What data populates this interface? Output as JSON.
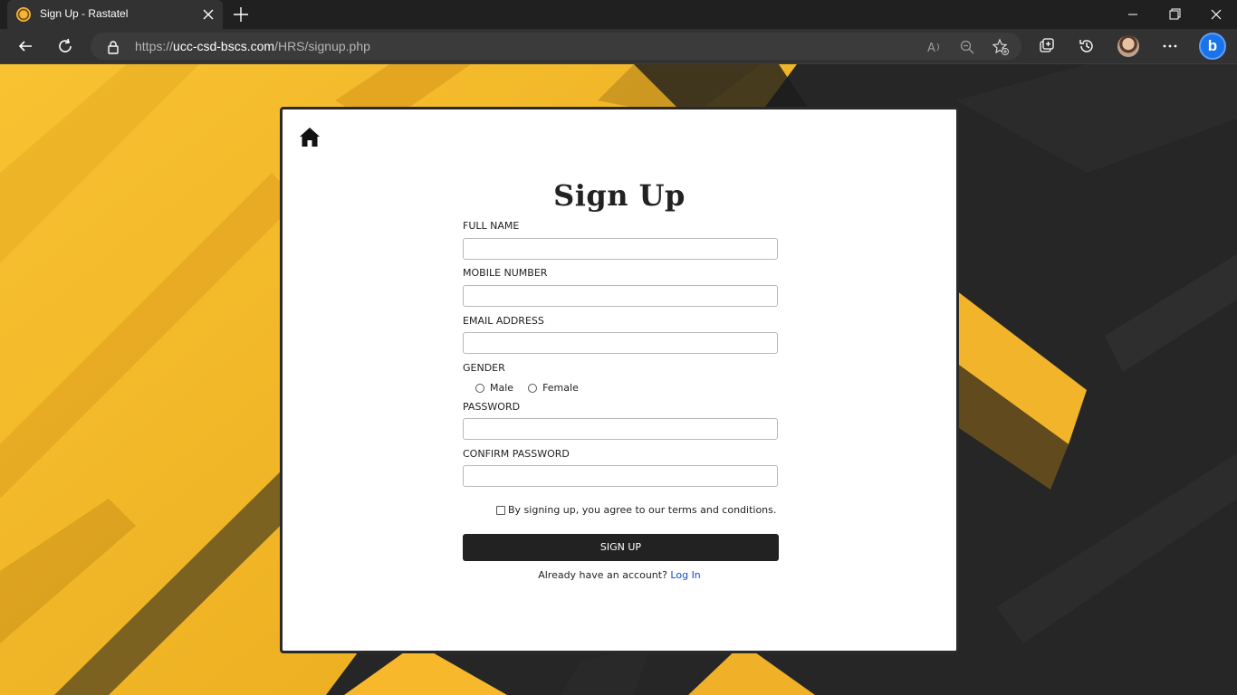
{
  "browser": {
    "tab_title": "Sign Up - Rastatel",
    "url_scheme": "https://",
    "url_domain": "ucc-csd-bscs.com",
    "url_path": "/HRS/signup.php",
    "icons": {
      "favicon": "site-favicon-icon",
      "close_tab": "close-icon",
      "new_tab": "plus-icon",
      "back": "back-arrow-icon",
      "refresh": "refresh-icon",
      "lock": "lock-icon",
      "read_aloud": "read-aloud-icon",
      "zoom": "zoom-out-icon",
      "favorites": "add-favorite-icon",
      "collections": "collections-icon",
      "history": "history-icon",
      "profile": "profile-avatar",
      "more": "more-icon",
      "copilot": "bing-icon"
    }
  },
  "form": {
    "title": "Sign Up",
    "full_name_label": "FULL NAME",
    "full_name_value": "",
    "mobile_label": "MOBILE NUMBER",
    "mobile_value": "",
    "email_label": "EMAIL ADDRESS",
    "email_value": "",
    "gender_label": "GENDER",
    "gender_options": [
      "Male",
      "Female"
    ],
    "password_label": "PASSWORD",
    "password_value": "",
    "confirm_password_label": "CONFIRM PASSWORD",
    "confirm_password_value": "",
    "terms_text": "By signing up, you agree to our terms and conditions.",
    "submit_label": "SIGN UP",
    "login_prompt": "Already have an account?",
    "login_link": "Log In"
  },
  "colors": {
    "accent_yellow": "#f7b82b",
    "dark": "#222222",
    "link": "#1a47d1"
  }
}
